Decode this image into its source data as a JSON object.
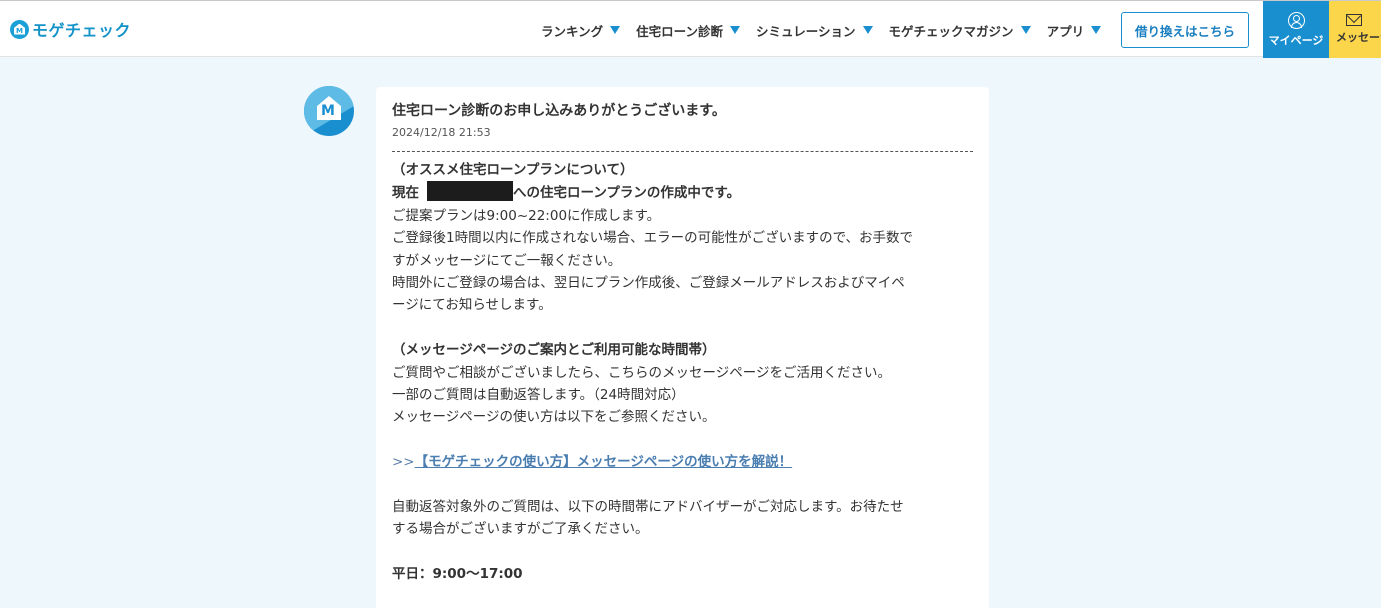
{
  "header": {
    "logo_text": "モゲチェック",
    "nav": [
      {
        "label": "ランキング"
      },
      {
        "label": "住宅ローン診断"
      },
      {
        "label": "シミュレーション"
      },
      {
        "label": "モゲチェックマガジン"
      },
      {
        "label": "アプリ"
      }
    ],
    "refinance_button": "借り換えはこちら",
    "mypage_label": "マイページ",
    "message_label": "メッセージ"
  },
  "colors": {
    "accent_blue": "#1a8fd0",
    "message_yellow": "#fbd54a",
    "page_bg": "#eef7fc"
  },
  "message": {
    "title": "住宅ローン診断のお申し込みありがとうございます。",
    "date": "2024/12/18 21:53",
    "sec1_heading": "（オススメ住宅ローンプランについて）",
    "sec1_line1_prefix": "現在",
    "sec1_line1_suffix": "への住宅ローンプランの作成中です。",
    "sec1_line2": "ご提案プランは9:00~22:00に作成します。",
    "sec1_line3a": "ご登録後1時間以内に作成されない場合、エラーの可能性がございますので、お手数で",
    "sec1_line3b": "すがメッセージにてご一報ください。",
    "sec1_line4a": "時間外にご登録の場合は、翌日にプラン作成後、ご登録メールアドレスおよびマイペ",
    "sec1_line4b": "ージにてお知らせします。",
    "sec2_heading": "（メッセージページのご案内とご利用可能な時間帯）",
    "sec2_line1": "ご質問やご相談がございましたら、こちらのメッセージページをご活用ください。",
    "sec2_line2": "一部のご質問は自動返答します。（24時間対応）",
    "sec2_line3": "メッセージページの使い方は以下をご参照ください。",
    "link_prefix": ">>",
    "link_text": "【モゲチェックの使い方】メッセージページの使い方を解説！",
    "sec3_line1a": "自動返答対象外のご質問は、以下の時間帯にアドバイザーがご対応します。お待たせ",
    "sec3_line1b": "する場合がございますがご了承ください。",
    "hours_weekday": "平日：9:00〜17:00"
  }
}
